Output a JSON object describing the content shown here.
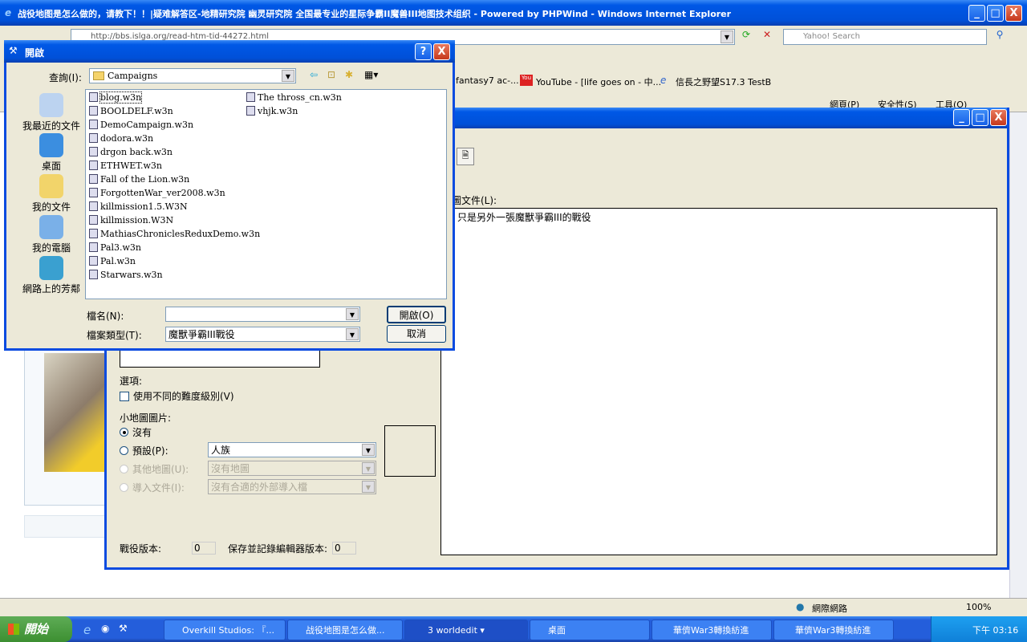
{
  "ie": {
    "title": "战役地图是怎么做的，请教下！！|疑难解答区-地精研究院 幽灵研究院 全国最专业的星际争霸II魔兽III地图技术组织 - Powered by PHPWind - Windows Internet Explorer",
    "address": "http://bbs.islga.org/read-htm-tid-44272.html",
    "search_placeholder": "Yahoo! Search",
    "favorites": [
      "fantasy7 ac-...",
      "YouTube - [life goes on - 中...",
      "信長之野望S17.3 TestB"
    ],
    "commands": [
      "網頁(P)",
      "安全性(S)",
      "工具(O)"
    ],
    "status_zone": "網際網路",
    "zoom": "100%"
  },
  "editor": {
    "doc_label": "圖文件(L):",
    "doc_text": "只是另外一張魔獸爭霸III的戰役",
    "options_label": "選項:",
    "difficulty_checkbox": "使用不同的難度級別(V)",
    "difficulty_checked": false,
    "minimap_label": "小地圖圖片:",
    "radio_none": "沒有",
    "radio_default": "預設(P):",
    "radio_default_value": "人族",
    "radio_other": "其他地圖(U):",
    "radio_other_value": "沒有地圖",
    "radio_import": "導入文件(I):",
    "radio_import_value": "沒有合適的外部導入檔",
    "selected_radio": "沒有",
    "campaign_version_label": "戰役版本:",
    "campaign_version": "0",
    "editor_version_label": "保存並記錄編輯器版本:",
    "editor_version": "0"
  },
  "dialog": {
    "title": "開啟",
    "lookin_label": "查詢(I):",
    "lookin_value": "Campaigns",
    "places": [
      "我最近的文件",
      "桌面",
      "我的文件",
      "我的電腦",
      "網路上的芳鄰"
    ],
    "files": [
      "blog.w3n",
      "BOOLDELF.w3n",
      "DemoCampaign.w3n",
      "dodora.w3n",
      "drgon back.w3n",
      "ETHWET.w3n",
      "Fall of the Lion.w3n",
      "ForgottenWar_ver2008.w3n",
      "killmission1.5.W3N",
      "killmission.W3N",
      "MathiasChroniclesReduxDemo.w3n",
      "Pal3.w3n",
      "Pal.w3n",
      "Starwars.w3n",
      "The thross_cn.w3n",
      "vhjk.w3n"
    ],
    "filename_label": "檔名(N):",
    "filename_value": "",
    "filetype_label": "檔案類型(T):",
    "filetype_value": "魔獸爭霸III戰役",
    "open_button": "開啟(O)",
    "cancel_button": "取消",
    "help": "?"
  },
  "taskbar": {
    "start": "開始",
    "tasks": [
      "Overkill Studios: 『...",
      "战役地图是怎么做...",
      "3 worldedit",
      "桌面",
      "華儕War3轉換紡進",
      "華儕War3轉換紡進"
    ],
    "clock": "下午 03:16"
  }
}
